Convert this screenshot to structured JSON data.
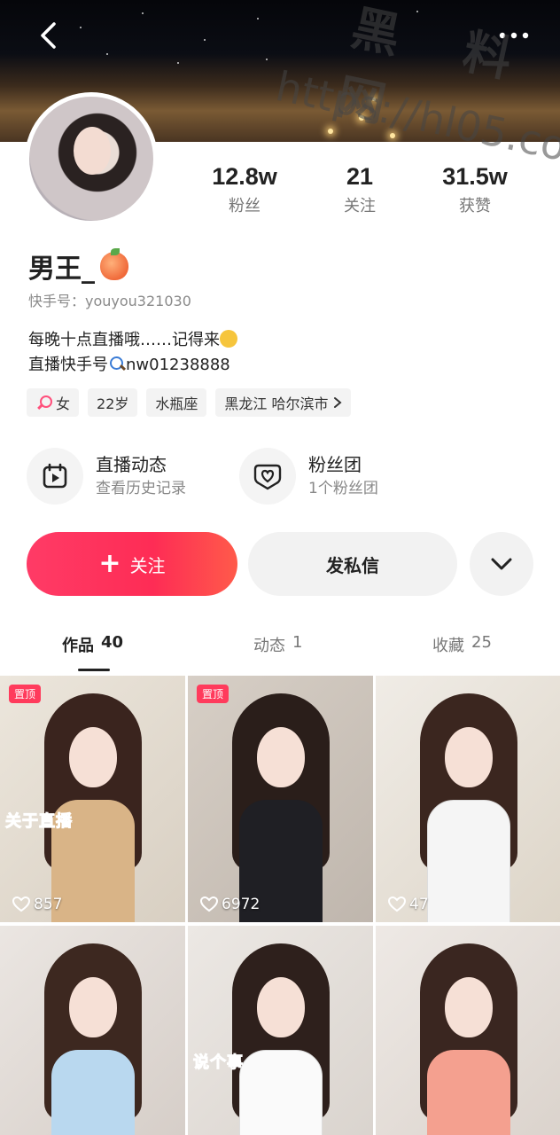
{
  "watermark": {
    "line1": "黑 料 网",
    "line2": "https://hl05.co"
  },
  "profile": {
    "name": "男王_",
    "user_id": "快手号：youyou321030",
    "bio_line1": "每晚十点直播哦……记得来",
    "bio_line2": "直播快手号",
    "bio_line2_id": "nw01238888"
  },
  "stats": [
    {
      "value": "12.8w",
      "label": "粉丝"
    },
    {
      "value": "21",
      "label": "关注"
    },
    {
      "value": "31.5w",
      "label": "获赞"
    }
  ],
  "tags": {
    "gender": "女",
    "age": "22岁",
    "zodiac": "水瓶座",
    "location": "黑龙江 哈尔滨市"
  },
  "features": [
    {
      "title": "直播动态",
      "subtitle": "查看历史记录",
      "icon": "calendar-play-icon"
    },
    {
      "title": "粉丝团",
      "subtitle": "1个粉丝团",
      "icon": "heart-badge-icon"
    }
  ],
  "actions": {
    "follow": "关注",
    "message": "发私信"
  },
  "tabs": [
    {
      "label": "作品",
      "count": "40"
    },
    {
      "label": "动态",
      "count": "1"
    },
    {
      "label": "收藏",
      "count": "25"
    }
  ],
  "videos": [
    {
      "pinned": "置顶",
      "overlay": "关于直播",
      "likes": "857"
    },
    {
      "pinned": "置顶",
      "overlay": "",
      "likes": "6972"
    },
    {
      "pinned": "",
      "overlay": "",
      "likes": "47"
    },
    {
      "pinned": "",
      "overlay": "",
      "likes": ""
    },
    {
      "pinned": "",
      "overlay": "说个事",
      "likes": ""
    },
    {
      "pinned": "",
      "overlay": "",
      "likes": ""
    }
  ],
  "colors": {
    "accent": "#fe2c55",
    "muted": "#888888"
  }
}
